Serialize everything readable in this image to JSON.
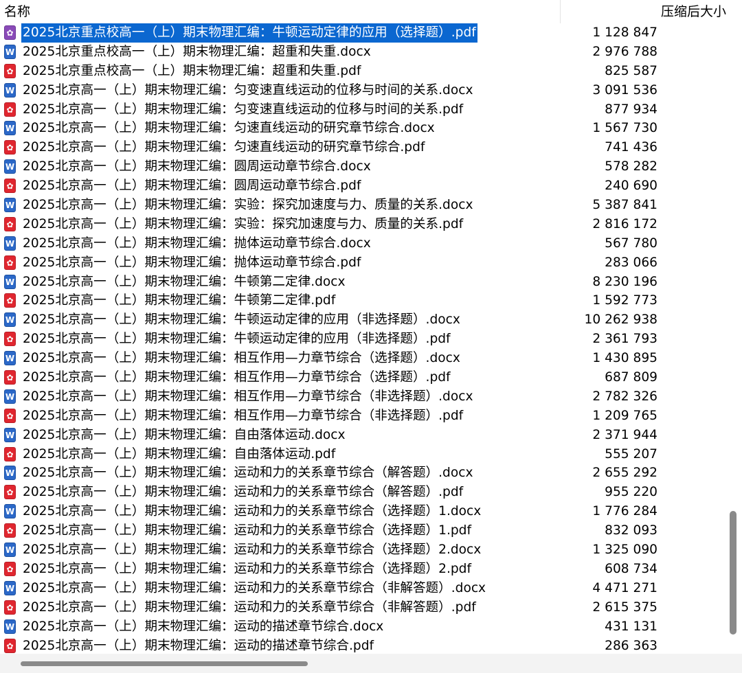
{
  "columns": {
    "name": "名称",
    "size": "压缩后大小"
  },
  "files": [
    {
      "name": "2025北京重点校高一（上）期末物理汇编：牛顿运动定律的应用（选择题）.pdf",
      "size": "1 128 847",
      "type": "pdf",
      "selected": true
    },
    {
      "name": "2025北京重点校高一（上）期末物理汇编：超重和失重.docx",
      "size": "2 976 788",
      "type": "docx"
    },
    {
      "name": "2025北京重点校高一（上）期末物理汇编：超重和失重.pdf",
      "size": "825 587",
      "type": "pdf"
    },
    {
      "name": "2025北京高一（上）期末物理汇编：匀变速直线运动的位移与时间的关系.docx",
      "size": "3 091 536",
      "type": "docx"
    },
    {
      "name": "2025北京高一（上）期末物理汇编：匀变速直线运动的位移与时间的关系.pdf",
      "size": "877 934",
      "type": "pdf"
    },
    {
      "name": "2025北京高一（上）期末物理汇编：匀速直线运动的研究章节综合.docx",
      "size": "1 567 730",
      "type": "docx"
    },
    {
      "name": "2025北京高一（上）期末物理汇编：匀速直线运动的研究章节综合.pdf",
      "size": "741 436",
      "type": "pdf"
    },
    {
      "name": "2025北京高一（上）期末物理汇编：圆周运动章节综合.docx",
      "size": "578 282",
      "type": "docx"
    },
    {
      "name": "2025北京高一（上）期末物理汇编：圆周运动章节综合.pdf",
      "size": "240 690",
      "type": "pdf"
    },
    {
      "name": "2025北京高一（上）期末物理汇编：实验：探究加速度与力、质量的关系.docx",
      "size": "5 387 841",
      "type": "docx"
    },
    {
      "name": "2025北京高一（上）期末物理汇编：实验：探究加速度与力、质量的关系.pdf",
      "size": "2 816 172",
      "type": "pdf"
    },
    {
      "name": "2025北京高一（上）期末物理汇编：抛体运动章节综合.docx",
      "size": "567 780",
      "type": "docx"
    },
    {
      "name": "2025北京高一（上）期末物理汇编：抛体运动章节综合.pdf",
      "size": "283 066",
      "type": "pdf"
    },
    {
      "name": "2025北京高一（上）期末物理汇编：牛顿第二定律.docx",
      "size": "8 230 196",
      "type": "docx"
    },
    {
      "name": "2025北京高一（上）期末物理汇编：牛顿第二定律.pdf",
      "size": "1 592 773",
      "type": "pdf"
    },
    {
      "name": "2025北京高一（上）期末物理汇编：牛顿运动定律的应用（非选择题）.docx",
      "size": "10 262 938",
      "type": "docx"
    },
    {
      "name": "2025北京高一（上）期末物理汇编：牛顿运动定律的应用（非选择题）.pdf",
      "size": "2 361 793",
      "type": "pdf"
    },
    {
      "name": "2025北京高一（上）期末物理汇编：相互作用—力章节综合（选择题）.docx",
      "size": "1 430 895",
      "type": "docx"
    },
    {
      "name": "2025北京高一（上）期末物理汇编：相互作用—力章节综合（选择题）.pdf",
      "size": "687 809",
      "type": "pdf"
    },
    {
      "name": "2025北京高一（上）期末物理汇编：相互作用—力章节综合（非选择题）.docx",
      "size": "2 782 326",
      "type": "docx"
    },
    {
      "name": "2025北京高一（上）期末物理汇编：相互作用—力章节综合（非选择题）.pdf",
      "size": "1 209 765",
      "type": "pdf"
    },
    {
      "name": "2025北京高一（上）期末物理汇编：自由落体运动.docx",
      "size": "2 371 944",
      "type": "docx"
    },
    {
      "name": "2025北京高一（上）期末物理汇编：自由落体运动.pdf",
      "size": "555 207",
      "type": "pdf"
    },
    {
      "name": "2025北京高一（上）期末物理汇编：运动和力的关系章节综合（解答题）.docx",
      "size": "2 655 292",
      "type": "docx"
    },
    {
      "name": "2025北京高一（上）期末物理汇编：运动和力的关系章节综合（解答题）.pdf",
      "size": "955 220",
      "type": "pdf"
    },
    {
      "name": "2025北京高一（上）期末物理汇编：运动和力的关系章节综合（选择题）1.docx",
      "size": "1 776 284",
      "type": "docx"
    },
    {
      "name": "2025北京高一（上）期末物理汇编：运动和力的关系章节综合（选择题）1.pdf",
      "size": "832 093",
      "type": "pdf"
    },
    {
      "name": "2025北京高一（上）期末物理汇编：运动和力的关系章节综合（选择题）2.docx",
      "size": "1 325 090",
      "type": "docx"
    },
    {
      "name": "2025北京高一（上）期末物理汇编：运动和力的关系章节综合（选择题）2.pdf",
      "size": "608 734",
      "type": "pdf"
    },
    {
      "name": "2025北京高一（上）期末物理汇编：运动和力的关系章节综合（非解答题）.docx",
      "size": "4 471 271",
      "type": "docx"
    },
    {
      "name": "2025北京高一（上）期末物理汇编：运动和力的关系章节综合（非解答题）.pdf",
      "size": "2 615 375",
      "type": "pdf"
    },
    {
      "name": "2025北京高一（上）期末物理汇编：运动的描述章节综合.docx",
      "size": "431 131",
      "type": "docx"
    },
    {
      "name": "2025北京高一（上）期末物理汇编：运动的描述章节综合.pdf",
      "size": "286 363",
      "type": "pdf"
    }
  ],
  "icons": {
    "docx": {
      "glyph": "W",
      "icon_name": "word-document-icon",
      "color": "#2b68c8"
    },
    "pdf": {
      "glyph": "✿",
      "icon_name": "pdf-document-icon",
      "color": "#e0262f"
    }
  },
  "colors": {
    "selection": "#0b67d0"
  }
}
